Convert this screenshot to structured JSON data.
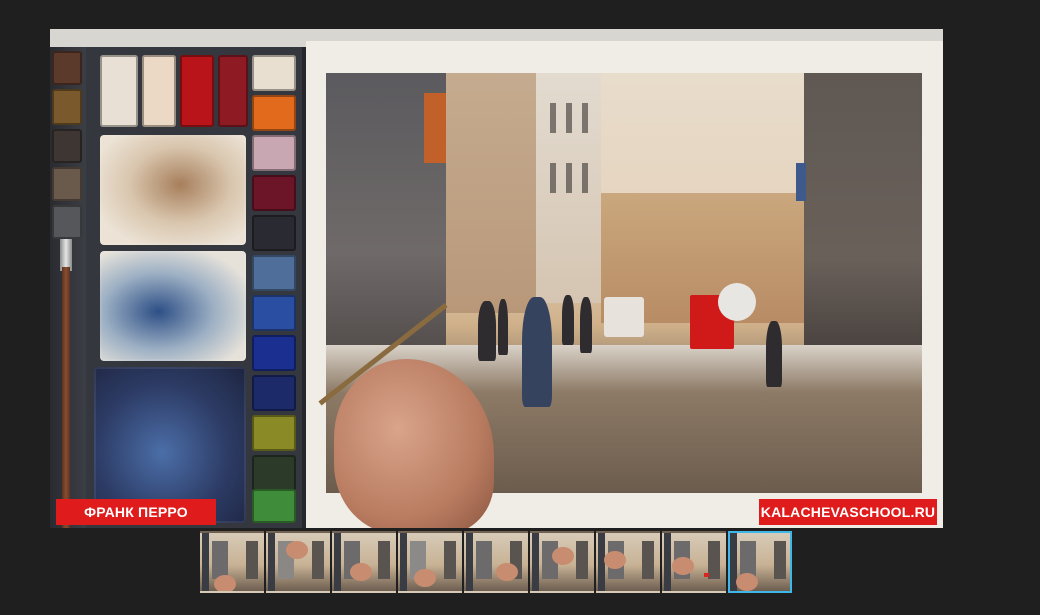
{
  "player": {
    "caption_left": "ФРАНК ПЕРРО",
    "caption_right": "KALACHEVASCHOOL.RU",
    "accent_color": "#e01b1b",
    "active_thumb_color": "#3fb6e8"
  },
  "thumbnails": {
    "count": 9,
    "active_index": 8
  }
}
